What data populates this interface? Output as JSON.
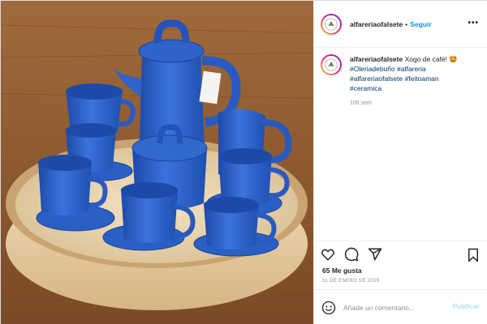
{
  "post": {
    "username": "alfareriaofalsete",
    "dot": "•",
    "follow_label": "Seguir",
    "more_label": "•••",
    "caption": {
      "username": "alfareriaofalsete",
      "text": "Xogo de café! 🤩",
      "hashtags": [
        "#Oleriadebuño #alfareria",
        "#alfareriaofalsete #feitoaman",
        "#ceramica"
      ],
      "time": "106 sem"
    },
    "likes_label": "65 Me gusta",
    "date": "31 DE ENERO DE 2019",
    "comment": {
      "placeholder": "Añade un comentario...",
      "publish_label": "Publicar"
    }
  },
  "icons": {
    "like": "heart-icon",
    "comment": "comment-icon",
    "share": "share-icon",
    "save": "bookmark-icon",
    "emoji": "emoji-icon",
    "more": "more-icon"
  },
  "colors": {
    "accent": "#0095f6",
    "hashtag": "#00376b",
    "publish_disabled": "#b2dffc",
    "ceramic_blue": "#2f63c9",
    "wood_tray": "#e2c79a",
    "table": "#8a5a33"
  }
}
